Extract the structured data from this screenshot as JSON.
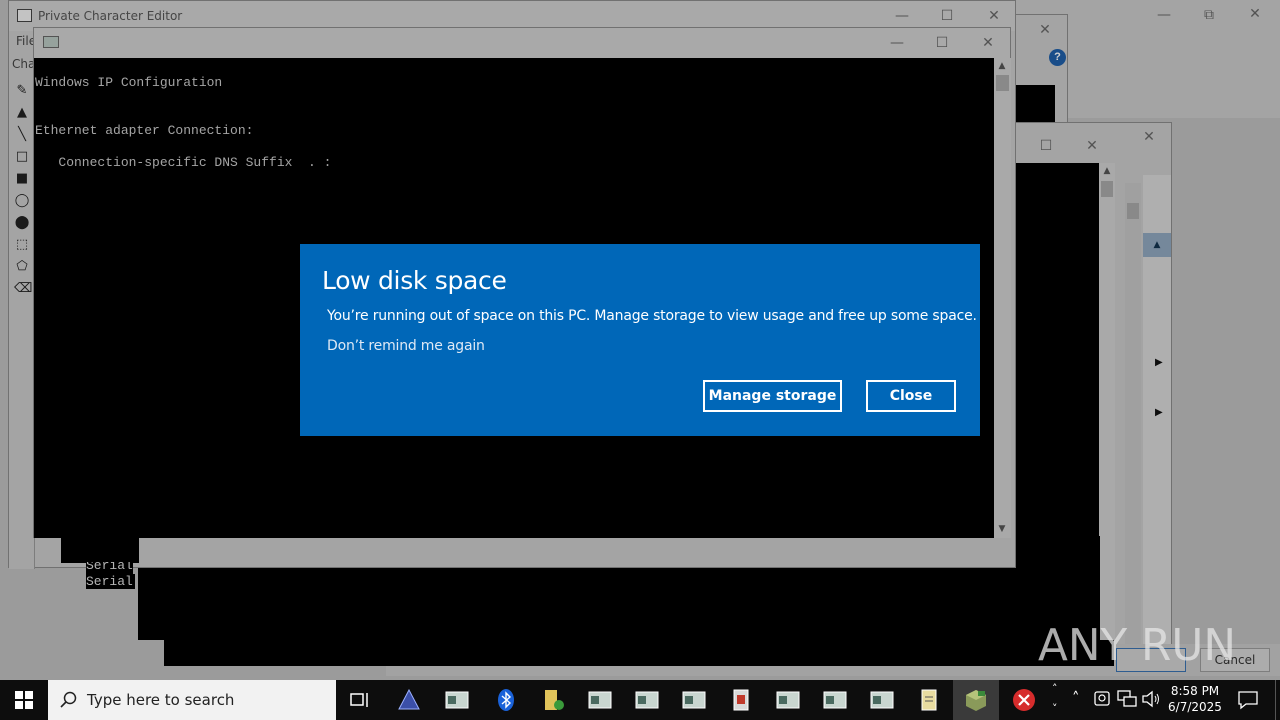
{
  "background_windows": {
    "pce_title": "Private Character Editor",
    "pce_menu_file": "File",
    "pce_menu_char": "Char",
    "pce_lower_text": [
      "Serial",
      "Serial"
    ],
    "cancel_button": "Cancel",
    "help_glyph": "?"
  },
  "console": {
    "line1": "Windows IP Configuration",
    "line2": "Ethernet adapter Connection:",
    "line3": "   Connection-specific DNS Suffix  . :"
  },
  "toast": {
    "title": "Low disk space",
    "message": "You’re running out of space on this PC. Manage storage to view usage and free up some space.",
    "remind": "Don’t remind me again",
    "manage_button": "Manage storage",
    "close_button": "Close",
    "bg_color": "#0067b8"
  },
  "taskbar": {
    "search_placeholder": "Type here to search",
    "time": "8:58 PM",
    "date": "6/7/2025"
  },
  "watermark": {
    "text": "ANY RUN"
  }
}
